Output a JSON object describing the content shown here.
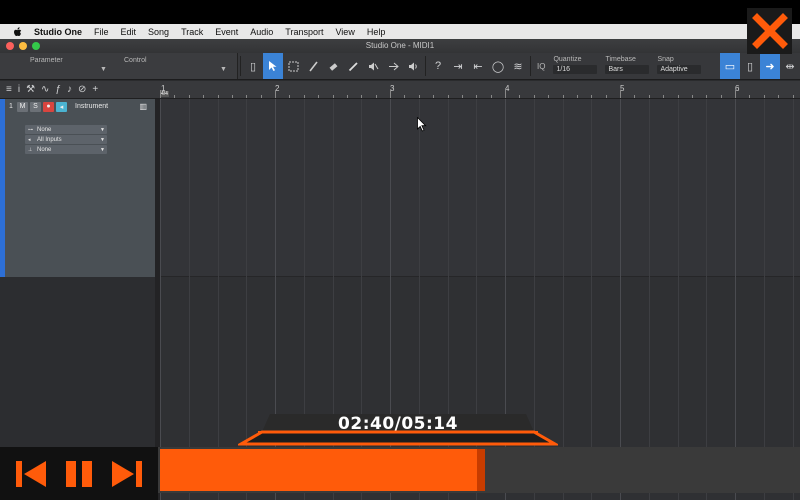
{
  "menubar": {
    "app_name": "Studio One",
    "items": [
      "File",
      "Edit",
      "Song",
      "Track",
      "Event",
      "Audio",
      "Transport",
      "View",
      "Help"
    ]
  },
  "window": {
    "title": "Studio One - MIDI1"
  },
  "toolbar": {
    "parameter_label": "Parameter",
    "control_label": "Control",
    "tools": [
      "arrow-tool-icon",
      "range-tool-icon",
      "split-tool-icon",
      "eraser-tool-icon",
      "paint-tool-icon",
      "mute-tool-icon",
      "bend-tool-icon",
      "listen-tool-icon"
    ],
    "iq_label": "IQ",
    "quantize": {
      "label": "Quantize",
      "value": "1/16"
    },
    "timebase": {
      "label": "Timebase",
      "value": "Bars"
    },
    "snap": {
      "label": "Snap",
      "value": "Adaptive"
    }
  },
  "ruler": {
    "bars": [
      "1",
      "2",
      "3",
      "4",
      "5",
      "6"
    ],
    "time_signature": "4/4"
  },
  "track": {
    "number": "1",
    "mute": "M",
    "solo": "S",
    "name": "Instrument",
    "output": "None",
    "input": "All Inputs",
    "channel": "None"
  },
  "player": {
    "time": "02:40/05:14",
    "progress": 0.509,
    "accent": "#ff5b0a"
  },
  "colors": {
    "track_color": "#2d6fd6",
    "record": "#d9453f",
    "monitor": "#4bb3d1",
    "active_tool": "#3b83d6"
  }
}
